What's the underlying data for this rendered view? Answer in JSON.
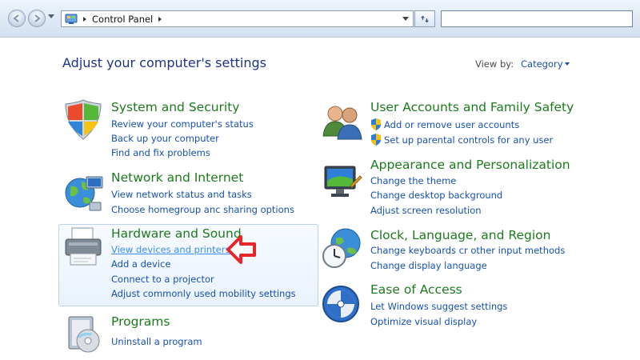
{
  "address_bar": {
    "breadcrumb": "Control Panel",
    "search_placeholder": ""
  },
  "heading": "Adjust your computer's settings",
  "view_by": {
    "label": "View by:",
    "value": "Category"
  },
  "categories": [
    {
      "title": "System and Security",
      "icon": "shield-icon",
      "links": [
        "Review your computer's status",
        "Back up your computer",
        "Find and fix problems"
      ]
    },
    {
      "title": "Network and Internet",
      "icon": "globe-network-icon",
      "links": [
        "View network status and tasks",
        "Choose homegroup anc sharing options"
      ]
    },
    {
      "title": "Hardware and Sound",
      "icon": "printer-icon",
      "links": [
        "View devices and printers",
        "Add a device",
        "Connect to a projector",
        "Adjust commonly used mobility settings"
      ]
    },
    {
      "title": "Programs",
      "icon": "programs-icon",
      "links": [
        "Uninstall a program"
      ]
    },
    {
      "title": "User Accounts and Family Safety",
      "icon": "users-icon",
      "links": [
        "Add or remove user accounts",
        "Set up parental controls for any user"
      ]
    },
    {
      "title": "Appearance and Personalization",
      "icon": "monitor-icon",
      "links": [
        "Change the theme",
        "Change desktop background",
        "Adjust screen resolution"
      ]
    },
    {
      "title": "Clock, Language, and Region",
      "icon": "clock-globe-icon",
      "links": [
        "Change keyboards cr other input methods",
        "Change display language"
      ]
    },
    {
      "title": "Ease of Access",
      "icon": "ease-of-access-icon",
      "links": [
        "Let Windows suggest settings",
        "Optimize visual display"
      ]
    }
  ],
  "colors": {
    "category_title": "#1d7a1d",
    "link": "#1750b0",
    "heading": "#1e3287",
    "highlight_arrow": "#e8262a"
  }
}
